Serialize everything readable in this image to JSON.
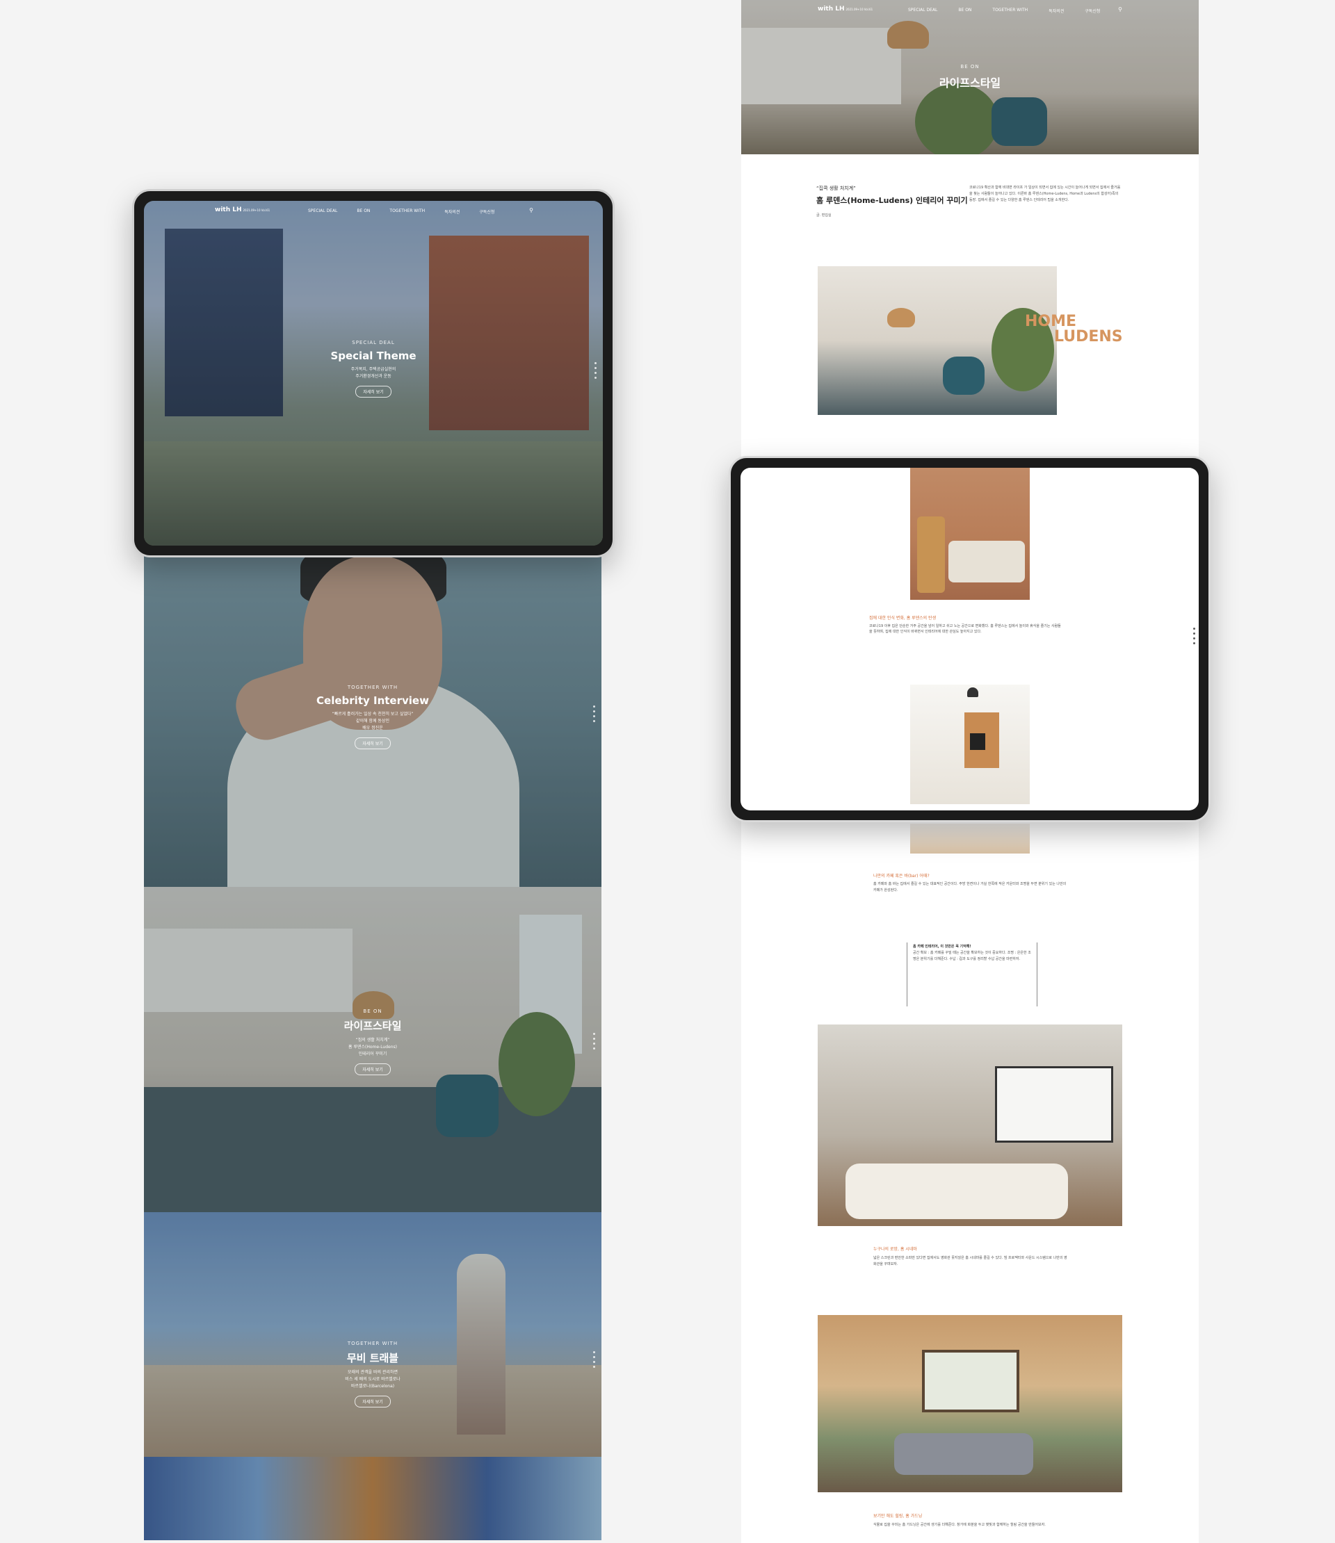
{
  "nav": {
    "logo_main": "with LH",
    "logo_sub": "2021.09+10 Vol.61",
    "items": [
      "SPECIAL DEAL",
      "BE ON",
      "TOGETHER WITH",
      "독자의견",
      "구독신청"
    ],
    "search_icon": "search-icon"
  },
  "special": {
    "category": "SPECIAL DEAL",
    "title": "Special Theme",
    "subtitle": "주거복지, 주택공급실현의\n주거환경개선과 운동",
    "button": "자세히 보기"
  },
  "celeb": {
    "category": "TOGETHER WITH",
    "title": "Celebrity Interview",
    "subtitle": "“빠르게 흘러가는 일상 속 천천히 보고 싶었다”\n같이해 함께 동상인\n배우 정진운",
    "button": "자세히 보기"
  },
  "lifestyle": {
    "category": "BE ON",
    "title": "라이프스타일",
    "subtitle": "“집의 생활 처치계”\n홈 루덴스(Home-Ludens)\n인테리어 꾸미기",
    "button": "자세히 보기"
  },
  "travel": {
    "category": "TOGETHER WITH",
    "title": "무비 트래블",
    "subtitle": "모래의 관객을 바의 관리하면\n비스 세 배의 도시로 바르셀로나\n바르셀로나(Barcelona)",
    "button": "자세히 보기"
  },
  "article": {
    "hero_category": "BE ON",
    "hero_title": "라이프스타일",
    "quote": "“집콕 생활 처치계”",
    "title": "홈 루덴스(Home-Ludens) 인테리어 꾸미기",
    "author": "글. 편집실",
    "intro": "코로나19 확산과 함께 비대면 라이프 가 일상이 되면서 집에 있는 시간이 늘어나게 되면서 집에서 즐거움을 찾는 사람들이 늘어나고 있다. 이른바 홈 루덴스(Home-Ludens, Home과 Ludens의 합성어)족의 등장. 집에서 즐길 수 있는 다양한 홈 루덴스 인테리어 팁을 소개한다.",
    "home_word": "HOME",
    "ludens_word": "LUDENS",
    "sec1_head": "집에 대한 인식 변화, 홈 루덴스의 탄생",
    "sec1_body": "코로나19 이후 집은 단순한 거주 공간을 넘어 일하고 쉬고 노는 공간으로 변화했다. 홈 루덴스는 집에서 놀이와 휴식을 즐기는 사람들을 뜻하며, 집에 대한 인식이 바뀌면서 인테리어에 대한 관심도 높아지고 있다.",
    "sec2_head": "나만의 카페 혹은 바(bar) 어때?",
    "sec2_body": "홈 카페와 홈 바는 집에서 즐길 수 있는 대표적인 공간이다. 주방 한켠이나 거실 한쪽에 작은 카운터와 조명을 두면 분위기 있는 나만의 카페가 완성된다.",
    "quote_title": "홈 카페 인테리어, 이 것만은 꼭 기억해!",
    "quote_body": "공간 확보 : 홈 카페를 꾸밀 때는 공간을 확보하는 것이 중요하다. 조명 : 은은한 조명은 분위기를 더해준다. 수납 : 컵과 도구를 정리할 수납 공간을 마련하자.",
    "sec3_head": "누구나의 로망, 홈 시네마",
    "sec3_body": "넓은 스크린과 편안한 소파만 있다면 집에서도 영화관 못지않은 홈 시네마를 즐길 수 있다. 빔 프로젝터와 사운드 시스템으로 나만의 영화관을 꾸며보자.",
    "sec4_head": "보기만 해도 힐링, 홈 가드닝",
    "sec4_body": "식물로 집을 꾸미는 홈 가드닝은 공간에 생기를 더해준다. 창가에 화분을 두고 햇빛과 함께하는 힐링 공간을 만들어보자."
  },
  "colors": {
    "accent": "#d46f3a",
    "background": "#f4f4f4",
    "tablet_frame": "#1b1b1b"
  }
}
